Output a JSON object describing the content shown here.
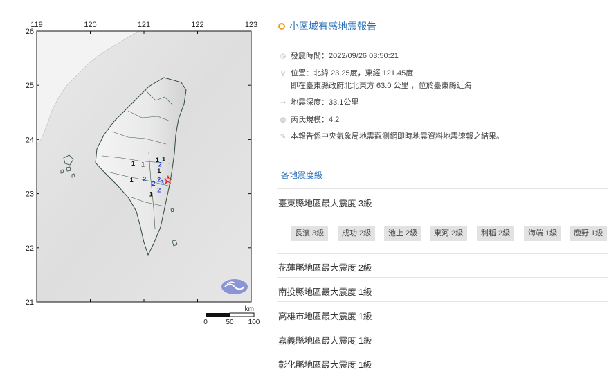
{
  "map": {
    "x_ticks": [
      "119",
      "120",
      "121",
      "122",
      "123"
    ],
    "y_ticks": [
      "26",
      "25",
      "24",
      "23",
      "22",
      "21"
    ],
    "scale_unit": "km",
    "scale_ticks": [
      "0",
      "50",
      "100"
    ],
    "epicenter": {
      "lat": 23.25,
      "lon": 121.45
    },
    "markers": [
      {
        "value": "1",
        "lon": 121.25,
        "lat": 23.58,
        "color": "#111111"
      },
      {
        "value": "1",
        "lon": 121.37,
        "lat": 23.6,
        "color": "#111111"
      },
      {
        "value": "2",
        "lon": 121.3,
        "lat": 23.5,
        "color": "#1f3fd0"
      },
      {
        "value": "1",
        "lon": 120.8,
        "lat": 23.52,
        "color": "#111111"
      },
      {
        "value": "1",
        "lon": 120.98,
        "lat": 23.5,
        "color": "#111111"
      },
      {
        "value": "1",
        "lon": 121.28,
        "lat": 23.38,
        "color": "#111111"
      },
      {
        "value": "1",
        "lon": 120.77,
        "lat": 23.21,
        "color": "#111111"
      },
      {
        "value": "2",
        "lon": 121.01,
        "lat": 23.23,
        "color": "#1f3fd0"
      },
      {
        "value": "2",
        "lon": 121.28,
        "lat": 23.22,
        "color": "#1f3fd0"
      },
      {
        "value": "2",
        "lon": 121.18,
        "lat": 23.15,
        "color": "#1f3fd0"
      },
      {
        "value": "3",
        "lon": 121.34,
        "lat": 23.17,
        "color": "#1f3fd0"
      },
      {
        "value": "2",
        "lon": 121.28,
        "lat": 23.03,
        "color": "#1f3fd0"
      },
      {
        "value": "1",
        "lon": 121.13,
        "lat": 22.95,
        "color": "#111111"
      }
    ]
  },
  "report": {
    "title": "小區域有感地震報告",
    "time_label": "發震時間：2022/09/26 03:50:21",
    "location_label": "位置：北緯 23.25度，東經 121.45度",
    "location_detail": "即在臺東縣政府北北東方 63.0 公里 ，位於臺東縣近海",
    "depth_label": "地震深度：33.1公里",
    "magnitude_label": "芮氏規模：4.2",
    "note": "本報告係中央氣象局地震觀測網即時地震資料地震速報之結果。"
  },
  "intensity": {
    "section_title": "各地震度級",
    "counties": [
      {
        "label": "臺東縣地區最大震度 3級"
      },
      {
        "label": "花蓮縣地區最大震度 2級"
      },
      {
        "label": "南投縣地區最大震度 1級"
      },
      {
        "label": "高雄市地區最大震度 1級"
      },
      {
        "label": "嘉義縣地區最大震度 1級"
      },
      {
        "label": "彰化縣地區最大震度 1級"
      }
    ],
    "taitung_stations": [
      "長濱 3級",
      "成功 2級",
      "池上 2級",
      "東河 2級",
      "利稻 2級",
      "海端 1級",
      "鹿野 1級"
    ]
  }
}
